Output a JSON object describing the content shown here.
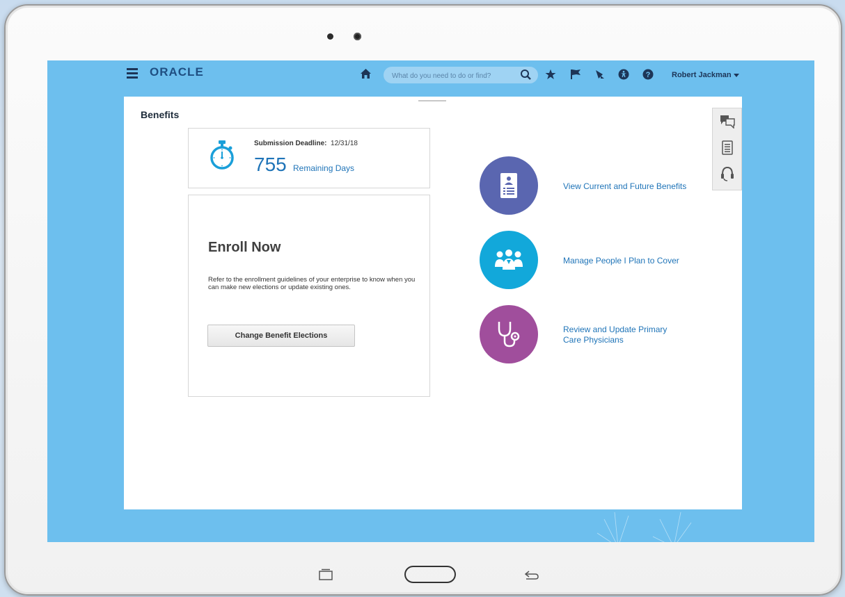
{
  "app": {
    "logo": "ORACLE"
  },
  "search": {
    "placeholder": "What do you need to do or find?"
  },
  "user": {
    "name": "Robert Jackman"
  },
  "page": {
    "title": "Benefits"
  },
  "deadline": {
    "label": "Submission Deadline:",
    "date": "12/31/18",
    "days": "755",
    "days_text": "Remaining Days"
  },
  "enroll": {
    "title": "Enroll Now",
    "description": "Refer to the enrollment guidelines of your enterprise to know when you can make new elections or update existing ones.",
    "button": "Change Benefit Elections"
  },
  "actions": [
    {
      "label": "View Current and Future Benefits",
      "icon": "id-card-icon",
      "color": "#5a66b0"
    },
    {
      "label": "Manage People I Plan to Cover",
      "icon": "people-icon",
      "color": "#12a8da"
    },
    {
      "label": "Review and Update Primary Care Physicians",
      "icon": "stethoscope-icon",
      "color": "#a04e9c"
    }
  ],
  "colors": {
    "screen_bg": "#6dbfee",
    "link": "#1f74b8",
    "header_text": "#1d3557"
  }
}
